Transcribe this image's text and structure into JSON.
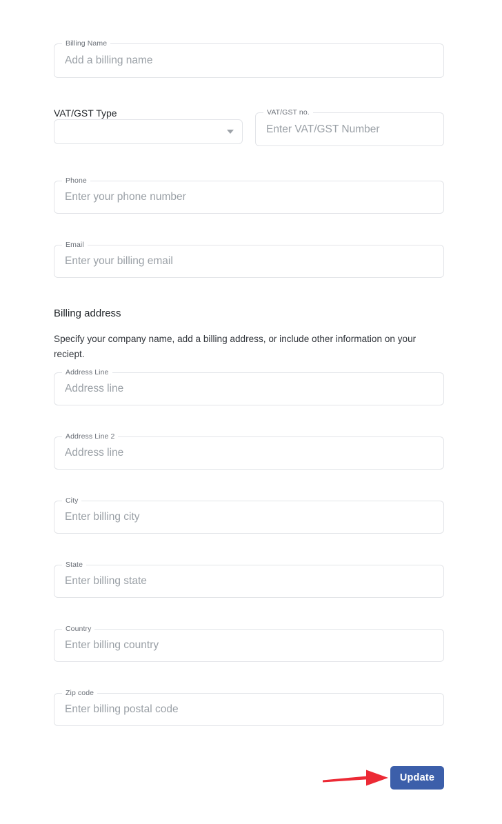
{
  "page": {
    "background_color": "#ffffff"
  },
  "billing_contact": {
    "billing_name": {
      "label": "Billing Name",
      "placeholder": "Add a billing name",
      "value": ""
    },
    "vat_gst_type": {
      "label": "VAT/GST Type",
      "value": "",
      "placeholder": "",
      "icon": "chevron-down-icon"
    },
    "vat_gst_no": {
      "label": "VAT/GST no.",
      "placeholder": "Enter VAT/GST Number",
      "value": ""
    },
    "phone": {
      "label": "Phone",
      "placeholder": "Enter your phone number",
      "value": ""
    },
    "email": {
      "label": "Email",
      "placeholder": "Enter your billing email",
      "value": ""
    }
  },
  "billing_address": {
    "title": "Billing address",
    "description": "Specify your company name, add a billing address, or include other information on your reciept.",
    "fields": [
      {
        "name": "address-line",
        "label": "Address Line",
        "placeholder": "Address line",
        "value": ""
      },
      {
        "name": "address-line-2",
        "label": "Address Line 2",
        "placeholder": "Address line",
        "value": ""
      },
      {
        "name": "city",
        "label": "City",
        "placeholder": "Enter billing city",
        "value": ""
      },
      {
        "name": "state",
        "label": "State",
        "placeholder": "Enter billing state",
        "value": ""
      },
      {
        "name": "country",
        "label": "Country",
        "placeholder": "Enter billing country",
        "value": ""
      },
      {
        "name": "zip-code",
        "label": "Zip code",
        "placeholder": "Enter billing postal code",
        "value": ""
      }
    ]
  },
  "actions": {
    "update_label": "Update",
    "update_color": "#3c5faa"
  },
  "annotation": {
    "arrow_color": "#ec2a35",
    "points_to": "Update"
  }
}
